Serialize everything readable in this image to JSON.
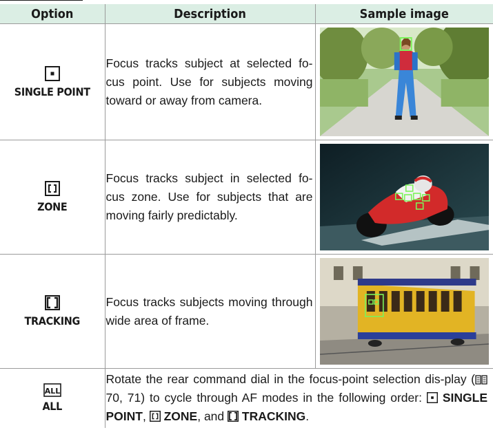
{
  "headers": {
    "option": "Option",
    "description": "Description",
    "sample": "Sample image"
  },
  "rows": [
    {
      "icon": "single-point-icon",
      "label": "SINGLE POINT",
      "description": "Focus tracks subject at selected fo-cus point. Use for subjects moving toward or away from camera."
    },
    {
      "icon": "zone-icon",
      "label": "ZONE",
      "description": "Focus tracks subject in selected fo-cus zone. Use for subjects that are moving fairly predictably."
    },
    {
      "icon": "tracking-icon",
      "label": "TRACKING",
      "description": "Focus tracks subjects moving through wide area of frame."
    }
  ],
  "all_row": {
    "icon": "all-icon",
    "icon_text": "ALL",
    "label": "ALL",
    "desc_part1": "Rotate the rear command dial in the focus-point selection dis-play (",
    "page_refs": "70, 71",
    "desc_part2": ") to cycle through AF modes in the following order: ",
    "mode1": "SINGLE POINT",
    "sep1": ", ",
    "mode2": "ZONE",
    "sep2": ", and ",
    "mode3": "TRACKING",
    "end": "."
  },
  "colors": {
    "header_bg": "#dbeee4",
    "focus_frame": "#7cf35a"
  }
}
